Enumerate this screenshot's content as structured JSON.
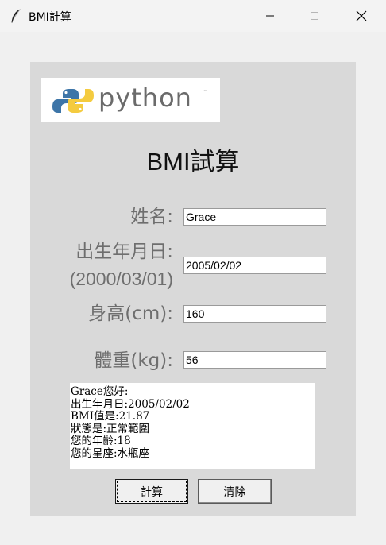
{
  "window": {
    "title": "BMI計算",
    "app_icon": "feather-icon",
    "controls": [
      "minimize-icon",
      "maximize-icon",
      "close-icon"
    ]
  },
  "logo": {
    "text": "python",
    "tm": "™"
  },
  "heading": "BMI試算",
  "form": {
    "name_label": "姓名:",
    "birth_label": "出生年月日:",
    "birth_hint": "(2000/03/01)",
    "height_label": "身高(cm):",
    "weight_label": "體重(kg):",
    "name_value": "Grace",
    "birth_value": "2005/02/02",
    "height_value": "160",
    "weight_value": "56"
  },
  "output": {
    "lines": [
      "Grace您好:",
      "出生年月日:2005/02/02",
      "BMI值是:21.87",
      "狀態是:正常範圍",
      "您的年齡:18",
      "您的星座:水瓶座"
    ]
  },
  "buttons": {
    "calculate": "計算",
    "clear": "清除"
  },
  "colors": {
    "panel": "#d9d9d9",
    "window_bg": "#f0f0f0",
    "python_blue": "#3d75a8",
    "python_yellow": "#f4cb3f"
  }
}
